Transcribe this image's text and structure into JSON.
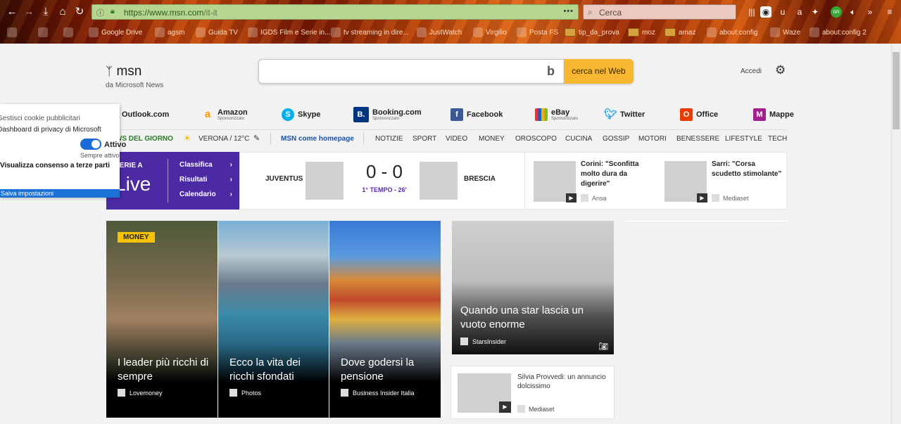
{
  "browser": {
    "url": "https://www.msn.com/it-it",
    "url_host": "https://www.msn.com",
    "url_path": "/it-it",
    "url_more": "•••",
    "search_placeholder": "Cerca",
    "bookmarks": [
      "Google Drive",
      "agsm",
      "Guida TV",
      "IGDS Film e Serie in...",
      "tv streaming in dire...",
      "JustWatch",
      "Virgilio",
      "Posta FS",
      "tip_da_prova",
      "moz",
      "amaz",
      "about:config",
      "Waze",
      "about:config 2"
    ],
    "addon_badge": "on"
  },
  "msn": {
    "logo": "msn",
    "logo_sub": "da Microsoft News",
    "search_button": "cerca nel Web",
    "signin": "Accedi"
  },
  "shortcuts": [
    {
      "label": "Outlook.com",
      "sub": "",
      "color": "#0072c6",
      "glyph": "O"
    },
    {
      "label": "Amazon",
      "sub": "Sponsorizzato",
      "color": "#ff9900",
      "glyph": "a"
    },
    {
      "label": "Skype",
      "sub": "",
      "color": "#00aff0",
      "glyph": "S"
    },
    {
      "label": "Booking.com",
      "sub": "Sponsorizzato",
      "color": "#003580",
      "glyph": "B."
    },
    {
      "label": "Facebook",
      "sub": "",
      "color": "#3b5998",
      "glyph": "f"
    },
    {
      "label": "eBay",
      "sub": "Sponsorizzato",
      "color": "#86b817",
      "glyph": "e"
    },
    {
      "label": "Twitter",
      "sub": "",
      "color": "#1da1f2",
      "glyph": "t"
    },
    {
      "label": "Office",
      "sub": "",
      "color": "#eb3c00",
      "glyph": "O"
    },
    {
      "label": "Mappe",
      "sub": "",
      "color": "#a31e8f",
      "glyph": "M"
    }
  ],
  "nav": {
    "news_today": "NEWS DEL GIORNO",
    "weather": "VERONA / 12°C",
    "homepage": "MSN come homepage",
    "items": [
      "NOTIZIE",
      "SPORT",
      "VIDEO",
      "MONEY",
      "OROSCOPO",
      "CUCINA",
      "GOSSIP",
      "MOTORI",
      "BENESSERE",
      "LIFESTYLE",
      "TECH"
    ]
  },
  "sport": {
    "league": "SERIE A",
    "live": "Live",
    "links": [
      "Classifica",
      "Risultati",
      "Calendario"
    ],
    "home": "JUVENTUS",
    "away": "BRESCIA",
    "score": "0 - 0",
    "status": "1° TEMPO - 26'"
  },
  "side_news": [
    {
      "title": "Corini: \"Sconfitta molto dura da digerire\"",
      "source": "Ansa"
    },
    {
      "title": "Sarri: \"Corsa scudetto stimolante\"",
      "source": "Mediaset"
    }
  ],
  "cards": [
    {
      "badge": "MONEY",
      "title": "I leader più ricchi di sempre",
      "source": "Lovemoney"
    },
    {
      "badge": "",
      "title": "Ecco la vita dei ricchi sfondati",
      "source": "Photos"
    },
    {
      "badge": "",
      "title": "Dove godersi la pensione",
      "source": "Business Insider Italia"
    }
  ],
  "star_card": {
    "title": "Quando una star lascia un vuoto enorme",
    "source": "StarsInsider"
  },
  "small_news": {
    "title": "Silvia Provvedi: un annuncio dolcissimo",
    "source": "Mediaset"
  },
  "cookie": {
    "manage": "Gestisci cookie pubblicitari",
    "dashboard": "Dashboard di privacy di Microsoft",
    "toggle_label": "Attivo",
    "always": "Sempre attivo",
    "third_party": "Visualizza consenso a terze parti",
    "save": "Salva impostazioni"
  }
}
